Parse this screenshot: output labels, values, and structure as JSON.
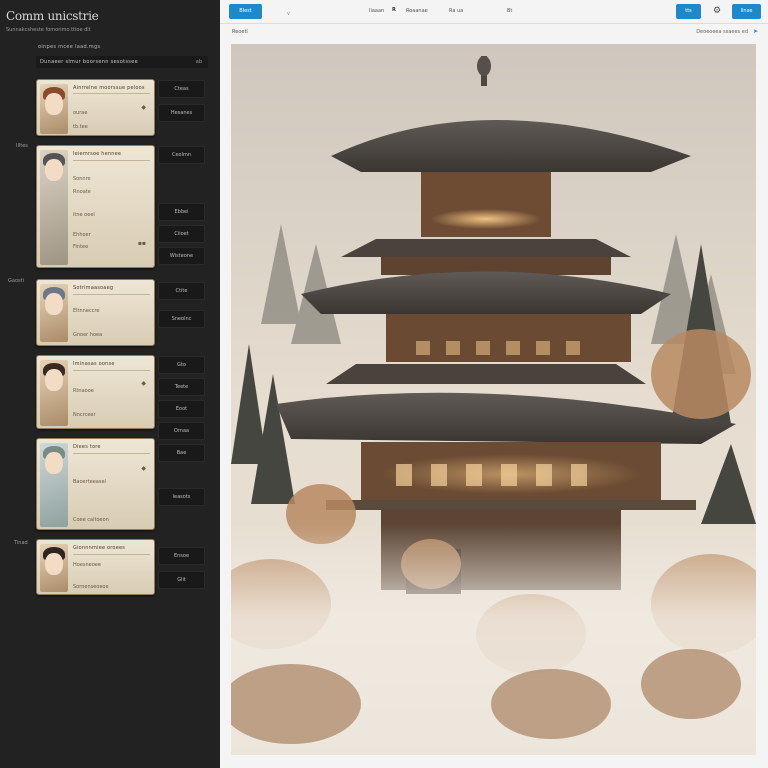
{
  "app": {
    "title": "Comm unicstrie",
    "subtitle": "Sunnakcsheste fomorimo.ttioe dit",
    "section_label": "oinpes mcee laad.mgs",
    "filter": {
      "label": "Dunaeer slmur boorsenn sesotssee",
      "count": "ab"
    }
  },
  "side_labels": [
    "Illtes",
    "Gaosti",
    "Tinad"
  ],
  "cards": [
    {
      "title": "Ainrrelne moorssue peloos",
      "lines": [
        "ourae",
        "tb.tee"
      ],
      "icon": "bell-icon"
    },
    {
      "title": "Ieiemrsoe hennee",
      "lines": [
        "Sonnre",
        "Rnoate",
        "itne oeel",
        "Ehhoer",
        "Fintee"
      ],
      "icon": "star-icon"
    },
    {
      "title": "Sotrimaasoaeg",
      "lines": [
        "Eltnneccre",
        "Gnoer hoea"
      ],
      "icon": ""
    },
    {
      "title": "Iminasas oonse",
      "lines": [
        "Rtnaooe",
        "Nncrceer"
      ],
      "icon": "bell-icon"
    },
    {
      "title": "Diees tore",
      "lines": [
        "Baoerteeasel",
        "Coee caitoeon"
      ],
      "icon": "bell-icon"
    },
    {
      "title": "Gionnnmiee oroees",
      "lines": [
        "Hoesneoee",
        "Sornenseoeoe"
      ],
      "icon": ""
    }
  ],
  "side_buttons": [
    "Cteas",
    "Hesanes",
    "Ceolmn",
    "Ebbei",
    "Ciioet",
    "Wisteone",
    "Ctite",
    "Sneolnc",
    "Gto",
    "Teete",
    "Eoot",
    "Ornaa",
    "Bae",
    "Ieasots",
    "Ensoe",
    "Glit"
  ],
  "topbar": {
    "left_button": "Blest",
    "mark": "v",
    "center_items": [
      "Iiaaan",
      "R",
      "Roaanae",
      "Ra ua",
      "Bt"
    ],
    "right_button_1": "tts",
    "right_button_2": "Ilnxe",
    "gear_icon": "gear-icon"
  },
  "subbar": {
    "left": "Reoetl",
    "right": "Deoeoeea ssaees ed",
    "icon": "arrow-icon"
  },
  "image": {
    "subject": "pagoda-painting"
  },
  "colors": {
    "accent": "#1e88c8",
    "sidebar_bg": "#222222",
    "card_bg": "#e8dfcc",
    "main_bg": "#f4f4f4"
  }
}
